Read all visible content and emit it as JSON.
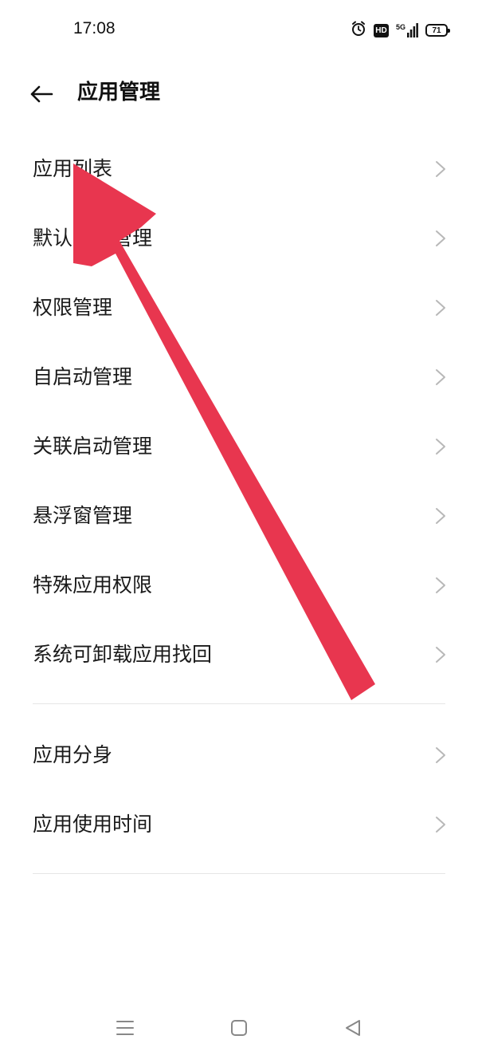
{
  "status_bar": {
    "time": "17:08",
    "network": "5G",
    "hd_label": "HD",
    "battery_level": "71",
    "icons": [
      "alarm-icon",
      "hd-icon",
      "signal-5g-icon",
      "battery-icon"
    ]
  },
  "header": {
    "title": "应用管理",
    "back_icon": "arrow-left-icon"
  },
  "menu": {
    "group1": [
      {
        "label": "应用列表"
      },
      {
        "label": "默认应用管理"
      },
      {
        "label": "权限管理"
      },
      {
        "label": "自启动管理"
      },
      {
        "label": "关联启动管理"
      },
      {
        "label": "悬浮窗管理"
      },
      {
        "label": "特殊应用权限"
      },
      {
        "label": "系统可卸载应用找回"
      }
    ],
    "group2": [
      {
        "label": "应用分身"
      },
      {
        "label": "应用使用时间"
      }
    ]
  },
  "annotation": {
    "color": "#e8364f",
    "icon": "annotation-arrow-icon"
  },
  "navigation": {
    "menu_icon": "menu-lines-icon",
    "home_icon": "square-home-icon",
    "back_icon": "triangle-back-icon"
  }
}
